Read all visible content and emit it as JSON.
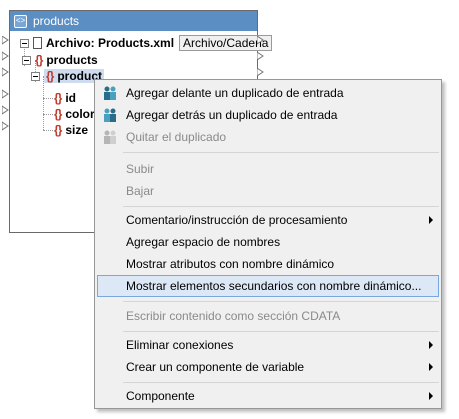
{
  "component": {
    "title": "products",
    "root_label": "Archivo: Products.xml",
    "root_badge": "Archivo/Cadena",
    "items": [
      "products",
      "product",
      "id",
      "color",
      "size"
    ]
  },
  "menu": {
    "items": [
      {
        "label": "Agregar delante un duplicado de entrada",
        "icon": "duplicate-before-icon",
        "disabled": false
      },
      {
        "label": "Agregar detrás un duplicado de entrada",
        "icon": "duplicate-after-icon",
        "disabled": false
      },
      {
        "label": "Quitar el duplicado",
        "icon": "remove-duplicate-icon",
        "disabled": true
      },
      {
        "label": "Subir",
        "disabled": true
      },
      {
        "label": "Bajar",
        "disabled": true
      },
      {
        "label": "Comentario/instrucción de procesamiento",
        "submenu": true
      },
      {
        "label": "Agregar espacio de nombres"
      },
      {
        "label": "Mostrar atributos con nombre dinámico"
      },
      {
        "label": "Mostrar elementos secundarios con nombre dinámico...",
        "highlighted": true
      },
      {
        "label": "Escribir contenido como sección CDATA",
        "disabled": true
      },
      {
        "label": "Eliminar conexiones",
        "submenu": true
      },
      {
        "label": "Crear un componente de variable",
        "submenu": true
      },
      {
        "label": "Componente",
        "submenu": true
      }
    ]
  },
  "colors": {
    "title_bar": "#5b8fc4",
    "element_icon": "#c0392b",
    "menu_bg": "#f0f0f0",
    "menu_highlight": "#dde8f6",
    "menu_highlight_border": "#7aa7de"
  }
}
